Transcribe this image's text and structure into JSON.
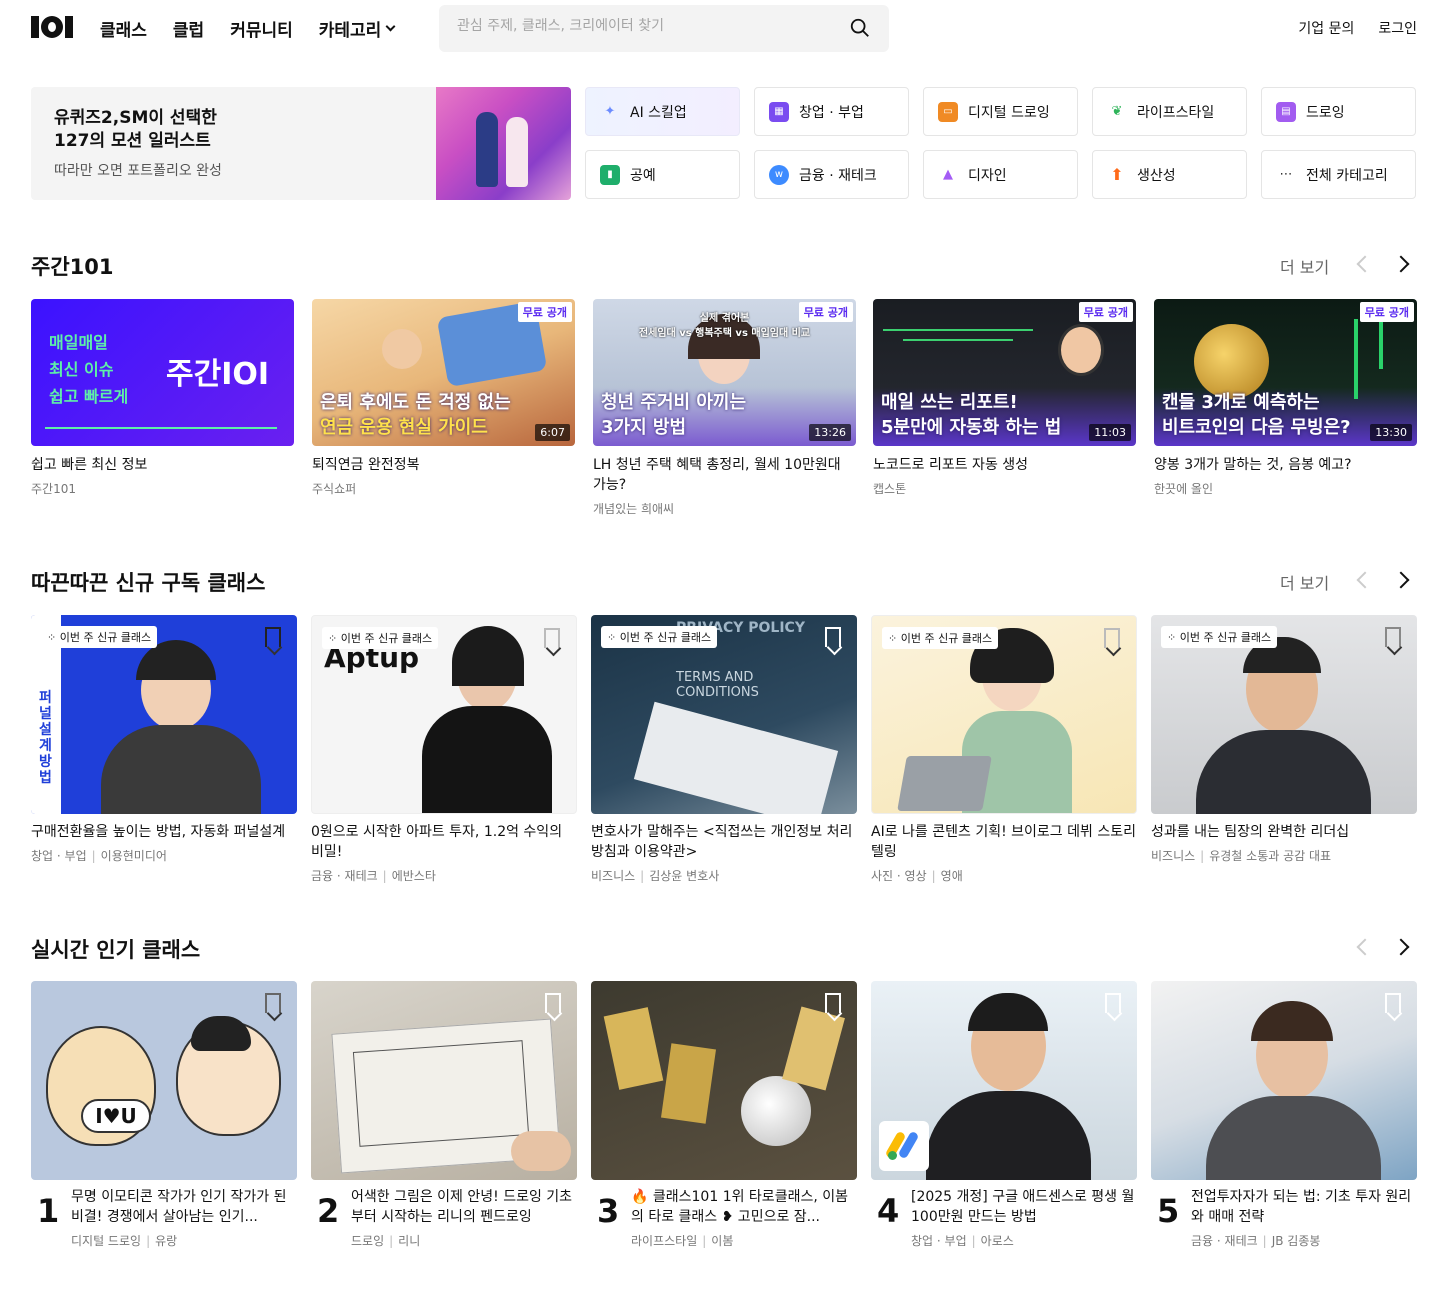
{
  "header": {
    "nav": [
      "클래스",
      "클럽",
      "커뮤니티",
      "카테고리"
    ],
    "search_placeholder": "관심 주제, 클래스, 크리에이터 찾기",
    "right": [
      "기업 문의",
      "로그인"
    ]
  },
  "banner": {
    "title_line1": "유퀴즈2,SM이 선택한",
    "title_line2": "127의 모션 일러스트",
    "subtitle": "따라만 오면 포트폴리오 완성"
  },
  "categories": [
    {
      "label": "AI 스킬업",
      "icon": "sparkle-icon",
      "color": "#6c8cff"
    },
    {
      "label": "창업 · 부업",
      "icon": "store-icon",
      "color": "#7a4cf0"
    },
    {
      "label": "디지털 드로잉",
      "icon": "tablet-icon",
      "color": "#f08a24"
    },
    {
      "label": "라이프스타일",
      "icon": "sprout-icon",
      "color": "#2fb45a"
    },
    {
      "label": "드로잉",
      "icon": "calendar-icon",
      "color": "#a25cf0"
    },
    {
      "label": "공예",
      "icon": "craft-icon",
      "color": "#1fae6b"
    },
    {
      "label": "금융 · 재테크",
      "icon": "coin-icon",
      "color": "#3d8bff"
    },
    {
      "label": "디자인",
      "icon": "shapes-icon",
      "color": "#a45cf5"
    },
    {
      "label": "생산성",
      "icon": "arrow-up-icon",
      "color": "#ff6b1a"
    },
    {
      "label": "전체 카테고리",
      "icon": "more-icon",
      "color": "#333333"
    }
  ],
  "weekly": {
    "title": "주간101",
    "more": "더 보기",
    "cards": [
      {
        "title": "쉽고 빠른 최신 정보",
        "sub": "주간101",
        "art_lines": [
          "매일매일",
          "최신 이슈",
          "쉽고 빠르게"
        ],
        "art_logo": "주간IOI"
      },
      {
        "title": "퇴직연금 완전정복",
        "sub": "주식쇼퍼",
        "badge": "무료 공개",
        "duration": "6:07",
        "cap1": "은퇴 후에도 돈 걱정 없는",
        "cap2": "연금 운용 현실 가이드"
      },
      {
        "title": "LH 청년 주택 혜택 총정리, 월세 10만원대 가능?",
        "sub": "개념있는 희애씨",
        "badge": "무료 공개",
        "duration": "13:26",
        "cap1": "청년 주거비 아끼는",
        "cap2": "3가지 방법",
        "top1": "실제 겪어본",
        "top2": "전세임대 vs 행복주택 vs 매입임대 비교"
      },
      {
        "title": "노코드로 리포트 자동 생성",
        "sub": "캡스톤",
        "badge": "무료 공개",
        "duration": "11:03",
        "cap1": "매일 쓰는 리포트!",
        "cap2": "5분만에 자동화 하는 법"
      },
      {
        "title": "양봉 3개가 말하는 것, 음봉 예고?",
        "sub": "한끗에 올인",
        "badge": "무료 공개",
        "duration": "13:30",
        "cap1": "캔들 3개로 예측하는",
        "cap2": "비트코인의 다음 무빙은?"
      }
    ]
  },
  "new_classes": {
    "title": "따끈따끈 신규 구독 클래스",
    "more": "더 보기",
    "tag": "이번 주 신규 클래스",
    "cards": [
      {
        "title": "구매전환율을 높이는 방법, 자동화 퍼널설계",
        "category": "창업 · 부업",
        "author": "이용현미디어",
        "side_text": "퍼널설계 방법"
      },
      {
        "title": "0원으로 시작한 아파트 투자, 1.2억 수익의 비밀!",
        "category": "금융 · 재테크",
        "author": "에반스타",
        "logo_text": "Aptup"
      },
      {
        "title": "변호사가 말해주는 <직접쓰는 개인정보 처리방침과 이용약관>",
        "category": "비즈니스",
        "author": "김상윤 변호사",
        "art1": "PRIVACY POLICY",
        "art2": "TERMS AND CONDITIONS"
      },
      {
        "title": "AI로 나를 콘텐츠 기획! 브이로그 데뷔 스토리텔링",
        "category": "사진 · 영상",
        "author": "영애"
      },
      {
        "title": "성과를 내는 팀장의 완벽한 리더십",
        "category": "비즈니스",
        "author": "유경철 소통과 공감 대표"
      }
    ]
  },
  "popular": {
    "title": "실시간 인기 클래스",
    "cards": [
      {
        "rank": "1",
        "title": "무명 이모티콘 작가가 인기 작가가 된 비결! 경쟁에서 살아남는 인기...",
        "category": "디지털 드로잉",
        "author": "유랑",
        "art_text": "I♥U"
      },
      {
        "rank": "2",
        "title": "어색한 그림은 이제 안녕! 드로잉 기초부터 시작하는 리니의 펜드로잉",
        "category": "드로잉",
        "author": "리니"
      },
      {
        "rank": "3",
        "title": "🔥 클래스101 1위 타로클래스, 이봄의 타로 클래스 ❥ 고민으로 잠...",
        "category": "라이프스타일",
        "author": "이봄"
      },
      {
        "rank": "4",
        "title": "[2025 개정] 구글 애드센스로 평생 월 100만원 만드는 방법",
        "category": "창업 · 부업",
        "author": "아로스"
      },
      {
        "rank": "5",
        "title": "전업투자자가 되는 법: 기초 투자 원리와 매매 전략",
        "category": "금융 · 재테크",
        "author": "JB 김종봉"
      }
    ]
  }
}
